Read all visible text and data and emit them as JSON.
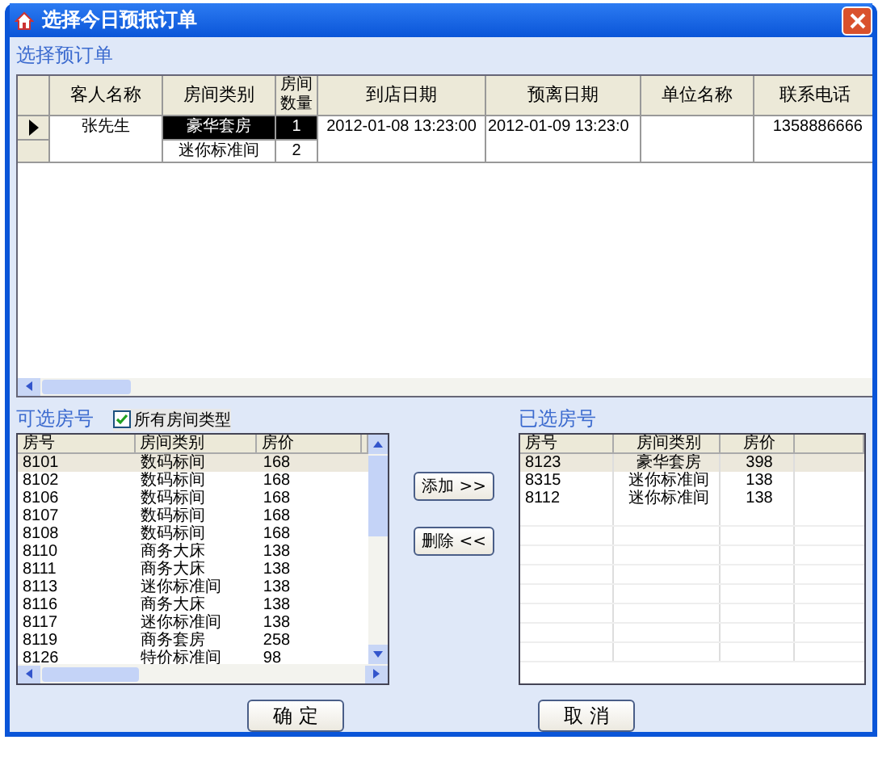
{
  "window": {
    "title": "选择今日预抵订单"
  },
  "bookings": {
    "title": "选择预订单",
    "columns": [
      "客人名称",
      "房间类别",
      "房间数量",
      "到店日期",
      "预离日期",
      "单位名称",
      "联系电话"
    ],
    "rows": [
      {
        "selected": true,
        "guest": "张先生",
        "rooms": [
          {
            "type": "豪华套房",
            "count": "1",
            "selected": true
          },
          {
            "type": "迷你标准间",
            "count": "2",
            "selected": false
          }
        ],
        "arrival": "2012-01-08 13:23:00",
        "departure": "2012-01-09 13:23:0",
        "phone": "1358886666"
      }
    ]
  },
  "available": {
    "title": "可选房号",
    "all_types": {
      "label": "所有房间类型",
      "checked": true
    },
    "columns": [
      "房号",
      "房间类别",
      "房价"
    ],
    "rows": [
      {
        "room": "8101",
        "type": "数码标间",
        "price": "168",
        "selected": true
      },
      {
        "room": "8102",
        "type": "数码标间",
        "price": "168",
        "selected": false
      },
      {
        "room": "8106",
        "type": "数码标间",
        "price": "168",
        "selected": false
      },
      {
        "room": "8107",
        "type": "数码标间",
        "price": "168",
        "selected": false
      },
      {
        "room": "8108",
        "type": "数码标间",
        "price": "168",
        "selected": false
      },
      {
        "room": "8110",
        "type": "商务大床",
        "price": "138",
        "selected": false
      },
      {
        "room": "8111",
        "type": "商务大床",
        "price": "138",
        "selected": false
      },
      {
        "room": "8113",
        "type": "迷你标准间",
        "price": "138",
        "selected": false
      },
      {
        "room": "8116",
        "type": "商务大床",
        "price": "138",
        "selected": false
      },
      {
        "room": "8117",
        "type": "迷你标准间",
        "price": "138",
        "selected": false
      },
      {
        "room": "8119",
        "type": "商务套房",
        "price": "258",
        "selected": false
      },
      {
        "room": "8126",
        "type": "特价标准间",
        "price": "98",
        "selected": false
      }
    ]
  },
  "actions": {
    "add": "添加 >>",
    "remove": "删除 <<"
  },
  "chosen": {
    "title": "已选房号",
    "columns": [
      "房号",
      "房间类别",
      "房价"
    ],
    "rows": [
      {
        "room": "8123",
        "type": "豪华套房",
        "price": "398",
        "selected": true
      },
      {
        "room": "8315",
        "type": "迷你标准间",
        "price": "138",
        "selected": false
      },
      {
        "room": "8112",
        "type": "迷你标准间",
        "price": "138",
        "selected": false
      }
    ]
  },
  "buttons": {
    "ok": "确 定",
    "cancel": "取 消"
  }
}
